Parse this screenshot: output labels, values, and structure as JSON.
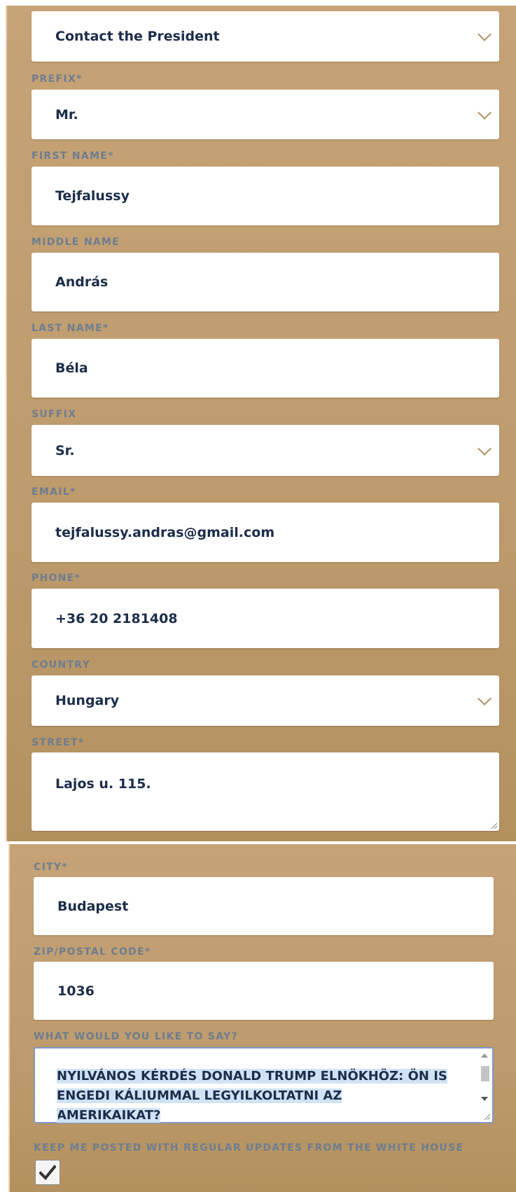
{
  "form": {
    "topic": {
      "value": "Contact the President"
    },
    "prefix": {
      "label": "PREFIX*",
      "value": "Mr."
    },
    "first_name": {
      "label": "FIRST NAME*",
      "value": "Tejfalussy"
    },
    "middle_name": {
      "label": "MIDDLE NAME",
      "value": "András"
    },
    "last_name": {
      "label": "LAST NAME*",
      "value": "Béla"
    },
    "suffix": {
      "label": "SUFFIX",
      "value": "Sr."
    },
    "email": {
      "label": "EMAIL*",
      "value": "tejfalussy.andras@gmail.com"
    },
    "phone": {
      "label": "PHONE*",
      "value": "+36 20 2181408"
    },
    "country": {
      "label": "COUNTRY",
      "value": "Hungary"
    },
    "street": {
      "label": "STREET*",
      "value": "Lajos u. 115."
    },
    "city": {
      "label": "CITY*",
      "value": "Budapest"
    },
    "zip": {
      "label": "ZIP/POSTAL CODE*",
      "value": "1036"
    },
    "message": {
      "label": "WHAT WOULD YOU LIKE TO SAY?",
      "value": "NYILVÁNOS KÉRDÉS DONALD TRUMP ELNÖKHÖZ: ÖN IS ENGEDI KÁLIUMMAL LEGYILKOLTATNI AZ AMERIKAIKAT?"
    },
    "updates": {
      "label": "KEEP ME POSTED WITH REGULAR UPDATES FROM THE WHITE HOUSE",
      "checked": true
    }
  },
  "icons": {
    "dropdown": "chevron-down-icon",
    "checkbox": "checkmark-icon"
  },
  "colors": {
    "panel": "#c6a376",
    "label": "#6d7d90",
    "value": "#1c2d4a",
    "chevron": "#b08f64",
    "focus_border": "#7e98c8",
    "selection": "#cfe3f5"
  }
}
